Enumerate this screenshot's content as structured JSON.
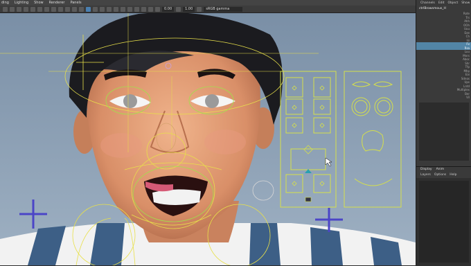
{
  "menu": [
    "ding",
    "Lighting",
    "Show",
    "Renderer",
    "Panels"
  ],
  "toolbar": {
    "field1": "0.00",
    "field2": "1.00",
    "colorspace": "sRGB gamma"
  },
  "channel_box": {
    "tabs": [
      "Channels",
      "Edit",
      "Object",
      "Show"
    ],
    "node": "ctrlBrowsmous_H",
    "attrs": [
      "Rote",
      "Trs",
      "Ahh",
      "OOh",
      "Uuu",
      "Eee",
      "Ch",
      "Iiii",
      "Fv",
      "Rsa",
      "Luu",
      "Mnrs",
      "Aboc",
      "Shr",
      "Tfp",
      "Mhp",
      "Eai",
      "Sdnos",
      "Ups",
      "Lntd",
      "Multiplex",
      "Ber",
      "Vil"
    ],
    "highlighted": [
      8,
      9
    ]
  },
  "layer_editor": {
    "tabs": [
      "Display",
      "Anim"
    ],
    "menus": [
      "Layers",
      "Options",
      "Help"
    ]
  },
  "colors": {
    "viewport_top": "#7a8fa6",
    "viewport_bottom": "#9fb1c3",
    "highlight": "#5285a6",
    "control_yellow": "#e8e04a",
    "control_green": "#9fe34a"
  }
}
